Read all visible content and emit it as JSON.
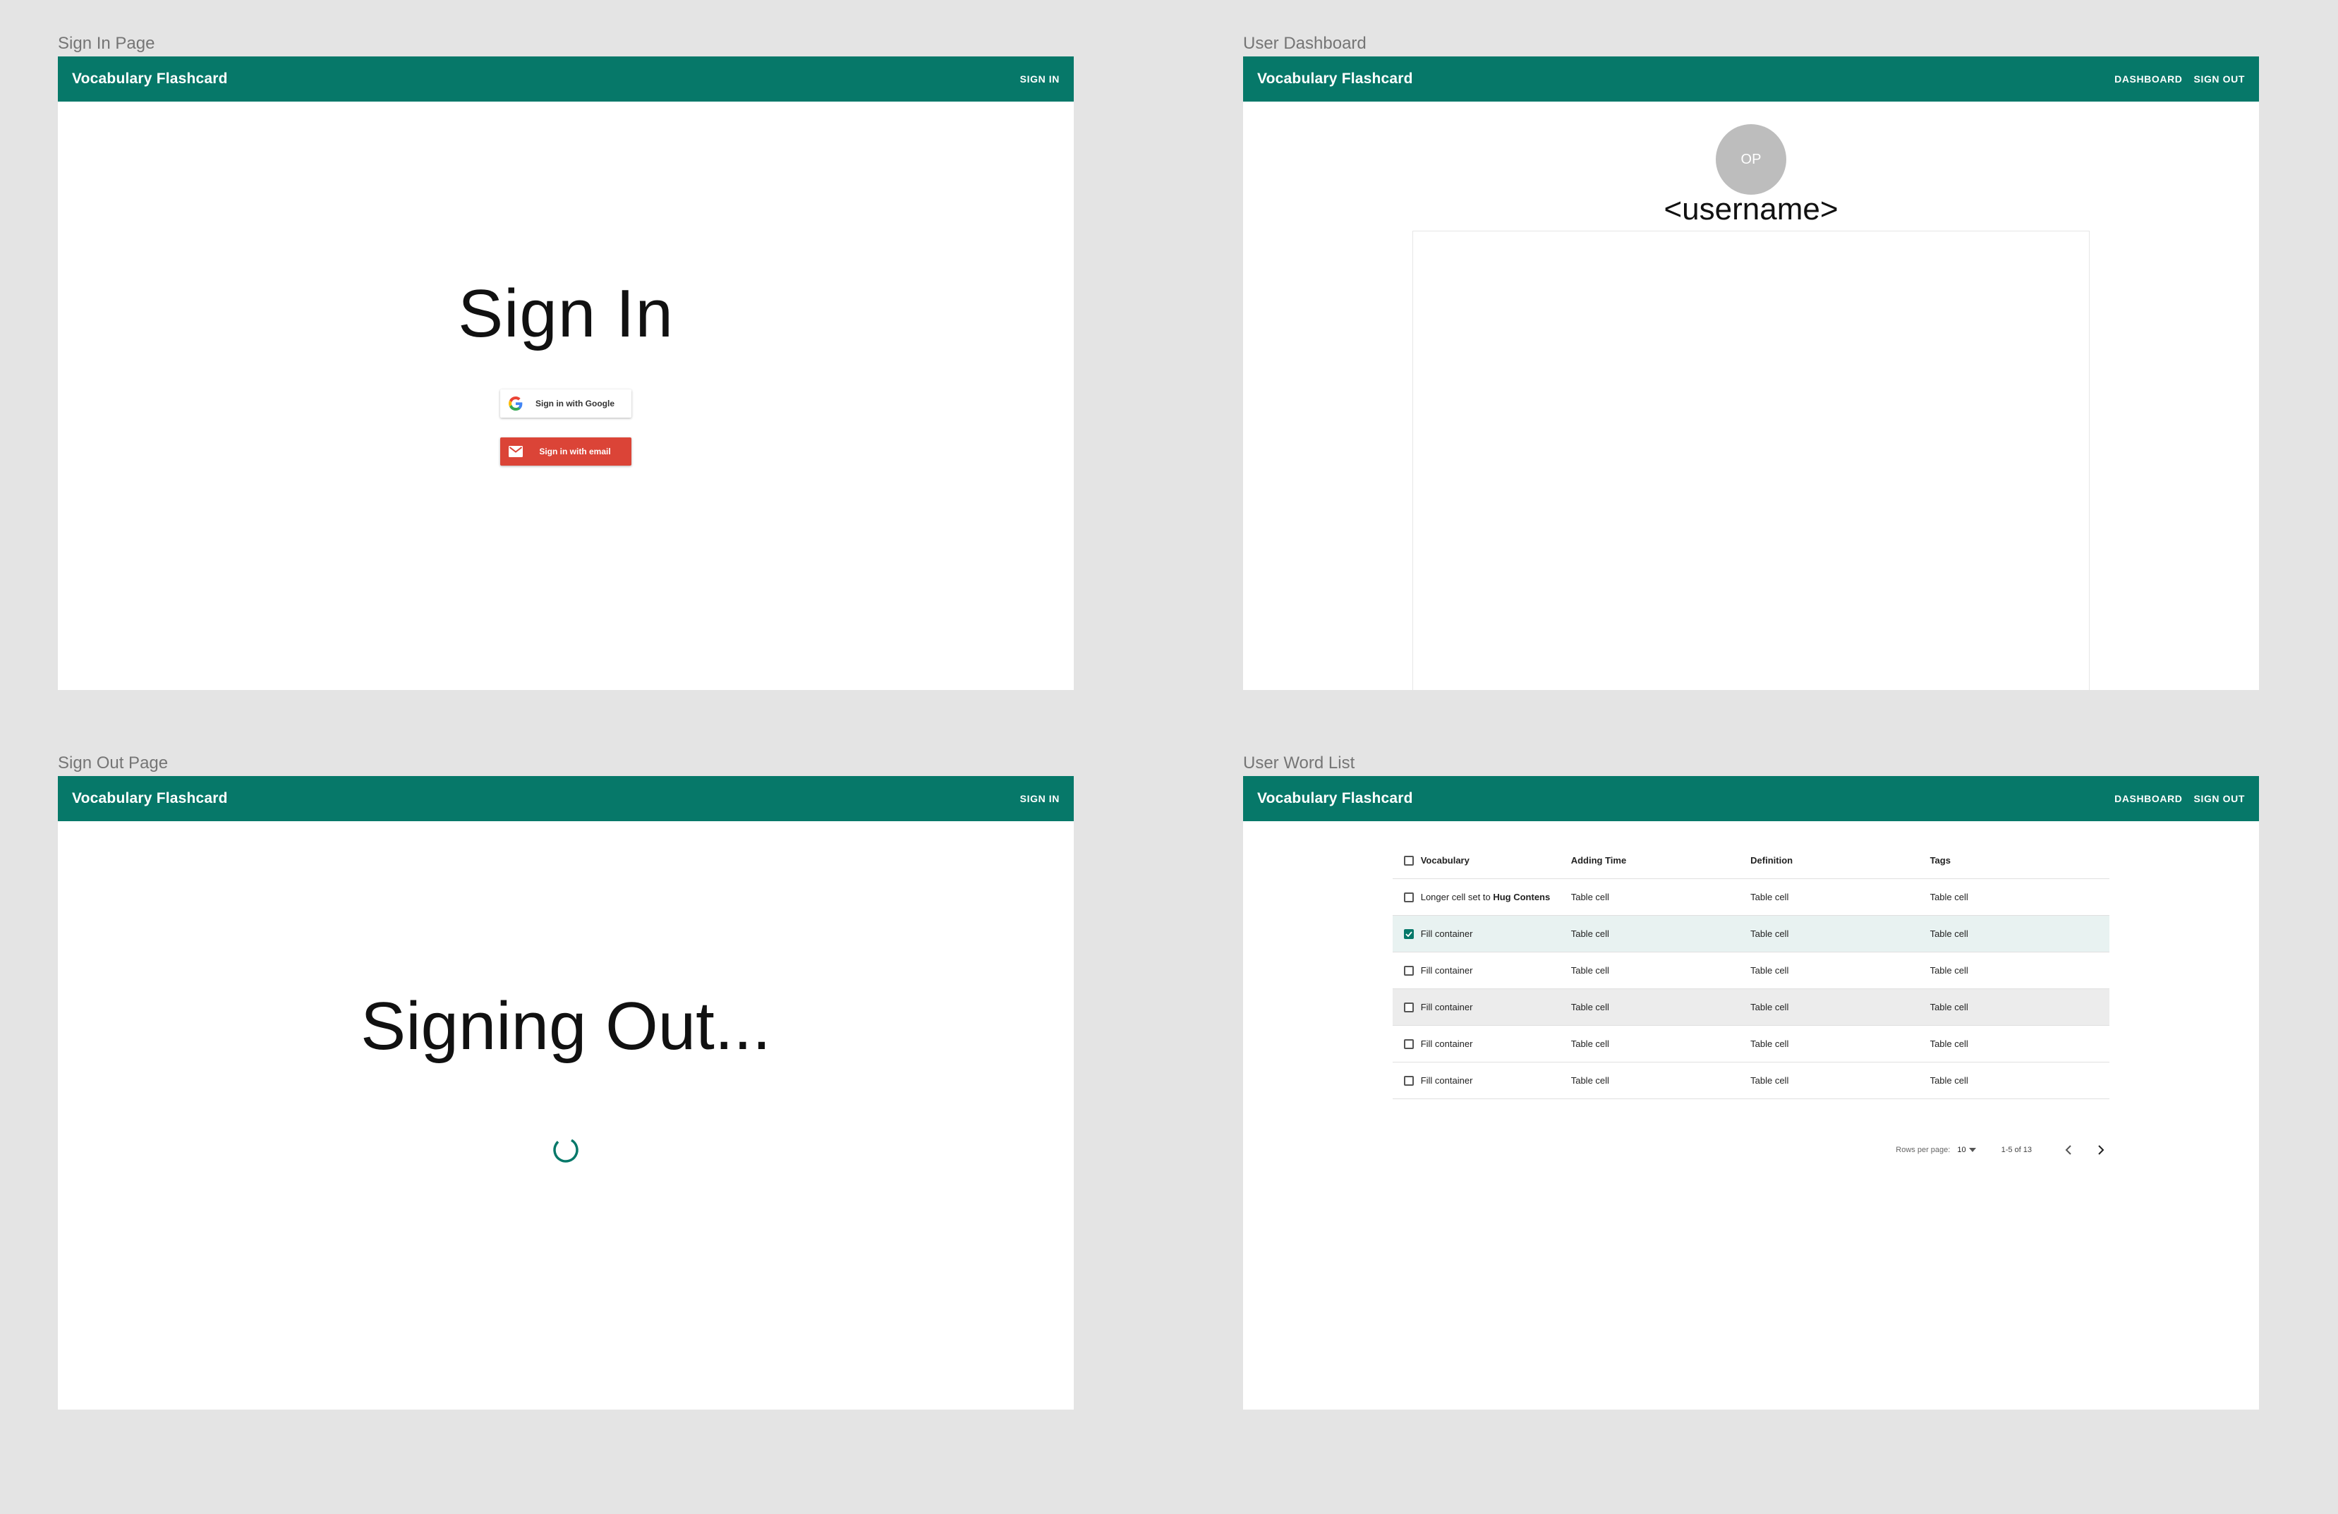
{
  "frames": {
    "signin": {
      "label": "Sign In Page"
    },
    "dashboard": {
      "label": "User Dashboard"
    },
    "signout": {
      "label": "Sign Out Page"
    },
    "wordlist": {
      "label": "User Word List"
    }
  },
  "appbar": {
    "title": "Vocabulary Flashcard",
    "sign_in": "SIGN IN",
    "dashboard": "DASHBOARD",
    "sign_out": "SIGN OUT"
  },
  "signin": {
    "heading": "Sign In",
    "google_button": "Sign in with Google",
    "email_button": "Sign in with email"
  },
  "dashboard": {
    "avatar_initials": "OP",
    "username": "<username>"
  },
  "signout": {
    "heading": "Signing Out..."
  },
  "wordlist": {
    "columns": [
      "Vocabulary",
      "Adding Time",
      "Definition",
      "Tags"
    ],
    "rows": [
      {
        "vocab_prefix": "Longer cell set to ",
        "vocab_bold": "Hug Contens",
        "adding_time": "Table cell",
        "definition": "Table cell",
        "tags": "Table cell",
        "checked": false,
        "state": "normal"
      },
      {
        "vocab_prefix": "Fill container",
        "vocab_bold": "",
        "adding_time": "Table cell",
        "definition": "Table cell",
        "tags": "Table cell",
        "checked": true,
        "state": "selected"
      },
      {
        "vocab_prefix": "Fill container",
        "vocab_bold": "",
        "adding_time": "Table cell",
        "definition": "Table cell",
        "tags": "Table cell",
        "checked": false,
        "state": "normal"
      },
      {
        "vocab_prefix": "Fill container",
        "vocab_bold": "",
        "adding_time": "Table cell",
        "definition": "Table cell",
        "tags": "Table cell",
        "checked": false,
        "state": "hover"
      },
      {
        "vocab_prefix": "Fill container",
        "vocab_bold": "",
        "adding_time": "Table cell",
        "definition": "Table cell",
        "tags": "Table cell",
        "checked": false,
        "state": "normal"
      },
      {
        "vocab_prefix": "Fill container",
        "vocab_bold": "",
        "adding_time": "Table cell",
        "definition": "Table cell",
        "tags": "Table cell",
        "checked": false,
        "state": "normal"
      }
    ],
    "pagination": {
      "rows_per_page_label": "Rows per page:",
      "rows_per_page_value": "10",
      "range": "1-5 of 13"
    }
  },
  "colors": {
    "primary": "#067869",
    "email_red": "#db4437",
    "avatar_gray": "#bdbdbd",
    "selected_row": "#e8f2f1",
    "hover_row": "#ececec"
  },
  "icons": [
    "google-logo-icon",
    "mail-icon",
    "spinner-icon",
    "checkbox-icon",
    "dropdown-arrow-icon",
    "chevron-left-icon",
    "chevron-right-icon"
  ]
}
